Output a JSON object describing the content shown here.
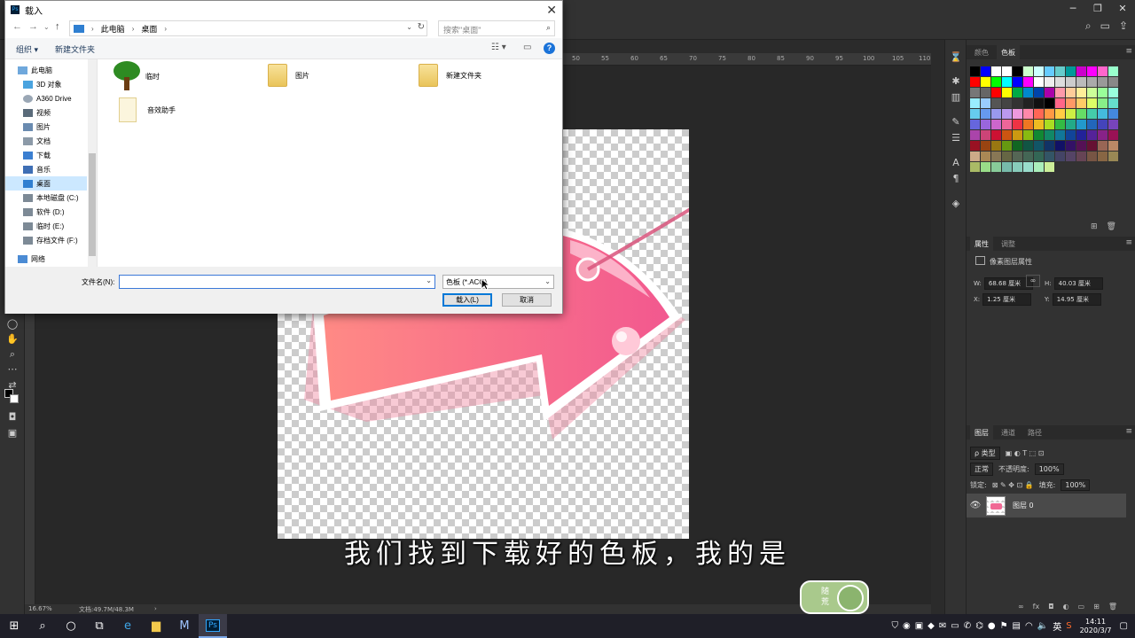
{
  "dialog": {
    "title": "载入",
    "address": [
      "此电脑",
      "桌面"
    ],
    "search_placeholder": "搜索\"桌面\"",
    "organize": "组织 ▾",
    "new_folder": "新建文件夹",
    "nav_items": [
      {
        "label": "此电脑",
        "icon": "computer-icon"
      },
      {
        "label": "3D 对象",
        "icon": "cube-icon"
      },
      {
        "label": "A360 Drive",
        "icon": "cloud-drive-icon"
      },
      {
        "label": "视频",
        "icon": "video-icon"
      },
      {
        "label": "图片",
        "icon": "image-icon"
      },
      {
        "label": "文档",
        "icon": "document-icon"
      },
      {
        "label": "下载",
        "icon": "download-icon"
      },
      {
        "label": "音乐",
        "icon": "music-icon"
      },
      {
        "label": "桌面",
        "icon": "desktop-icon",
        "selected": true
      },
      {
        "label": "本地磁盘 (C:)",
        "icon": "drive-icon"
      },
      {
        "label": "软件 (D:)",
        "icon": "drive-icon"
      },
      {
        "label": "临时 (E:)",
        "icon": "drive-icon"
      },
      {
        "label": "存档文件 (F:)",
        "icon": "drive-icon"
      },
      {
        "label": "网络",
        "icon": "network-icon"
      }
    ],
    "files": [
      "临时",
      "图片",
      "新建文件夹",
      "音效助手"
    ],
    "filename_label": "文件名(N):",
    "filename_value": "",
    "filetype": "色板 (*.ACO)",
    "load_button": "载入(L)",
    "cancel_button": "取消"
  },
  "ps": {
    "ruler_numbers": [
      "50",
      "55",
      "60",
      "65",
      "70",
      "75",
      "80",
      "85",
      "90",
      "95",
      "100",
      "105",
      "110"
    ],
    "zoom": "16.67%",
    "doc_info": "文档:49.7M/48.3M",
    "swatches_tabs": [
      "颜色",
      "色板"
    ],
    "properties_tabs": [
      "属性",
      "调整"
    ],
    "properties_title": "像素图层属性",
    "w_label": "W:",
    "w_value": "68.68 厘米",
    "h_label": "H:",
    "h_value": "40.03 厘米",
    "x_label": "X:",
    "x_value": "1.25 厘米",
    "y_label": "Y:",
    "y_value": "14.95 厘米",
    "layers_tabs": [
      "图层",
      "通道",
      "路径"
    ],
    "layer_filter": "ρ 类型",
    "blend_mode": "正常",
    "opacity_label": "不透明度:",
    "opacity_value": "100%",
    "lock_label": "锁定:",
    "fill_label": "填充:",
    "fill_value": "100%",
    "layer_name": "图层 0",
    "swatch_colors": [
      "#000000",
      "#0000ff",
      "#ffffff",
      "#ffffff",
      "#000000",
      "#ccffcc",
      "#ccffff",
      "#66ccff",
      "#66cccc",
      "#009999",
      "#cc00cc",
      "#ff00ff",
      "#ff66cc",
      "#99ffcc",
      "#ff0000",
      "#ffff00",
      "#00ff00",
      "#00ffff",
      "#0000ff",
      "#ff00ff",
      "#ffffff",
      "#eeeeee",
      "#dddddd",
      "#cccccc",
      "#bbbbbb",
      "#aaaaaa",
      "#999999",
      "#888888",
      "#777777",
      "#666666",
      "#ff0000",
      "#ffff00",
      "#00aa44",
      "#0088cc",
      "#0044aa",
      "#aa00aa",
      "#ff99aa",
      "#ffcc99",
      "#ffee99",
      "#ccff99",
      "#99ff99",
      "#99ffdd",
      "#99eeff",
      "#99ccff",
      "#555555",
      "#444444",
      "#333333",
      "#222222",
      "#111111",
      "#000000",
      "#ff6688",
      "#ff9966",
      "#ffcc66",
      "#ddff66",
      "#88ee88",
      "#66ddcc",
      "#66ccee",
      "#6699ee",
      "#9999ee",
      "#bb99ee",
      "#ee99dd",
      "#ff88aa",
      "#ff6655",
      "#ff9944",
      "#ffcc44",
      "#ccee44",
      "#66dd66",
      "#44ccaa",
      "#44bbdd",
      "#4488dd",
      "#6666dd",
      "#9966dd",
      "#cc66cc",
      "#ee6699",
      "#ee3344",
      "#ee7722",
      "#eebb22",
      "#aadd22",
      "#33bb44",
      "#22aa88",
      "#2299cc",
      "#2266bb",
      "#4444bb",
      "#7744bb",
      "#aa44aa",
      "#cc4477",
      "#cc1133",
      "#cc5511",
      "#cc9911",
      "#88bb11",
      "#118833",
      "#118866",
      "#117799",
      "#114499",
      "#222299",
      "#552299",
      "#882288",
      "#991155",
      "#991122",
      "#994411",
      "#997711",
      "#669911",
      "#116622",
      "#115544",
      "#115566",
      "#113366",
      "#111166",
      "#331166",
      "#551155",
      "#661133",
      "#996655",
      "#bb8866",
      "#ccaa88",
      "#aa8855",
      "#887755",
      "#666644",
      "#556655",
      "#446655",
      "#336655",
      "#335566",
      "#444466",
      "#554466",
      "#664455",
      "#775544",
      "#886644",
      "#998855",
      "#aabb66",
      "#99dd88",
      "#88cc99",
      "#77bbaa",
      "#88ccbb",
      "#99ddcc",
      "#aaeebb",
      "#ccee99"
    ]
  },
  "subtitle": "我们找到下载好的色板，我的是",
  "watermark": {
    "line1": "随",
    "line2": "荒"
  },
  "taskbar": {
    "time": "14:11",
    "date": "2020/3/7",
    "ime": "英"
  }
}
